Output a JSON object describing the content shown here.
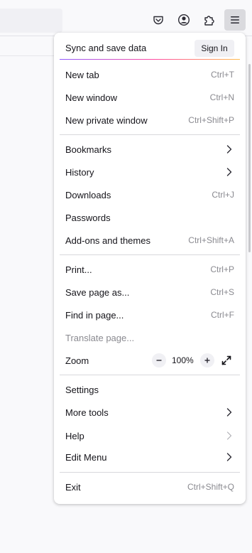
{
  "toolbar": {
    "buttons": [
      {
        "icon": "pocket-icon"
      },
      {
        "icon": "account-icon"
      },
      {
        "icon": "extensions-icon"
      },
      {
        "icon": "hamburger-menu-icon"
      }
    ]
  },
  "menu": {
    "sync": {
      "label": "Sync and save data",
      "sign_in": "Sign In"
    },
    "items": {
      "new_tab": {
        "label": "New tab",
        "shortcut": "Ctrl+T"
      },
      "new_window": {
        "label": "New window",
        "shortcut": "Ctrl+N"
      },
      "new_private_window": {
        "label": "New private window",
        "shortcut": "Ctrl+Shift+P"
      },
      "bookmarks": {
        "label": "Bookmarks"
      },
      "history": {
        "label": "History"
      },
      "downloads": {
        "label": "Downloads",
        "shortcut": "Ctrl+J"
      },
      "passwords": {
        "label": "Passwords"
      },
      "addons": {
        "label": "Add-ons and themes",
        "shortcut": "Ctrl+Shift+A"
      },
      "print": {
        "label": "Print...",
        "shortcut": "Ctrl+P"
      },
      "save_page": {
        "label": "Save page as...",
        "shortcut": "Ctrl+S"
      },
      "find": {
        "label": "Find in page...",
        "shortcut": "Ctrl+F"
      },
      "translate": {
        "label": "Translate page..."
      },
      "zoom": {
        "label": "Zoom",
        "value": "100%"
      },
      "settings": {
        "label": "Settings"
      },
      "more_tools": {
        "label": "More tools"
      },
      "help": {
        "label": "Help"
      },
      "edit_menu": {
        "label": "Edit Menu"
      },
      "exit": {
        "label": "Exit",
        "shortcut": "Ctrl+Shift+Q"
      }
    }
  },
  "colors": {
    "accent_gradient": [
      "#9059ff",
      "#ff4aa2",
      "#ffbd4f"
    ],
    "menu_bg": "#ffffff",
    "shortcut_text": "#8a8a90"
  }
}
